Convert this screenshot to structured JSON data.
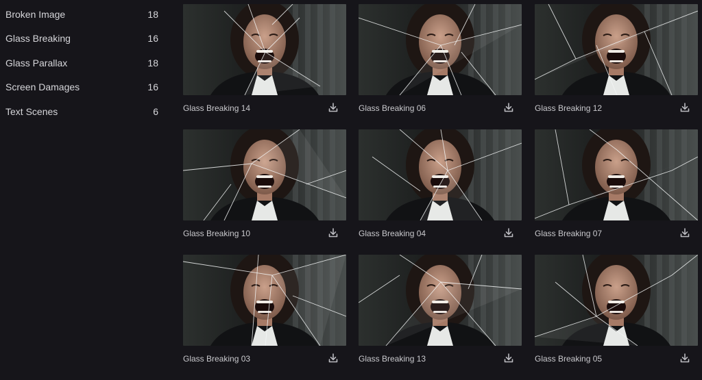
{
  "sidebar": {
    "categories": [
      {
        "label": "Broken Image",
        "count": "18"
      },
      {
        "label": "Glass Breaking",
        "count": "16"
      },
      {
        "label": "Glass Parallax",
        "count": "18"
      },
      {
        "label": "Screen Damages",
        "count": "16"
      },
      {
        "label": "Text Scenes",
        "count": "6"
      }
    ]
  },
  "grid": {
    "items": [
      {
        "title": "Glass Breaking 14",
        "thumbnail_icon": "shattered-glass-portrait",
        "download_icon": "download-icon"
      },
      {
        "title": "Glass Breaking 06",
        "thumbnail_icon": "shattered-glass-portrait",
        "download_icon": "download-icon"
      },
      {
        "title": "Glass Breaking 12",
        "thumbnail_icon": "shattered-glass-portrait",
        "download_icon": "download-icon"
      },
      {
        "title": "Glass Breaking 10",
        "thumbnail_icon": "shattered-glass-portrait",
        "download_icon": "download-icon"
      },
      {
        "title": "Glass Breaking 04",
        "thumbnail_icon": "shattered-glass-portrait",
        "download_icon": "download-icon"
      },
      {
        "title": "Glass Breaking 07",
        "thumbnail_icon": "shattered-glass-portrait",
        "download_icon": "download-icon"
      },
      {
        "title": "Glass Breaking 03",
        "thumbnail_icon": "shattered-glass-portrait",
        "download_icon": "download-icon"
      },
      {
        "title": "Glass Breaking 13",
        "thumbnail_icon": "shattered-glass-portrait",
        "download_icon": "download-icon"
      },
      {
        "title": "Glass Breaking 05",
        "thumbnail_icon": "shattered-glass-portrait",
        "download_icon": "download-icon"
      }
    ]
  },
  "colors": {
    "background": "#16151a",
    "text": "#d6d6da",
    "icon": "#bdbdc2"
  }
}
